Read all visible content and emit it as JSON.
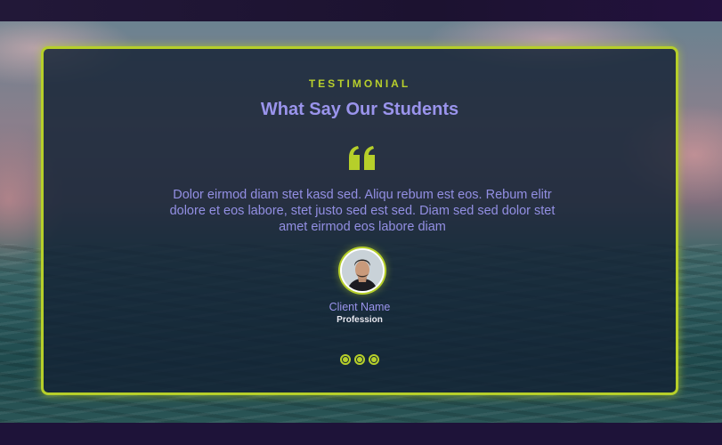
{
  "testimonial": {
    "eyebrow": "TESTIMONIAL",
    "title": "What Say Our Students",
    "quote_icon": "quote-left-icon",
    "text": "Dolor eirmod diam stet kasd sed. Aliqu rebum est eos. Rebum elitr dolore et eos labore, stet justo sed est sed. Diam sed sed dolor stet amet eirmod eos labore diam",
    "client_name": "Client Name",
    "profession": "Profession"
  },
  "carousel": {
    "dots": 3,
    "active_index": 0
  },
  "colors": {
    "accent": "#b6cf2a",
    "heading": "#9a94ec",
    "card_bg": "#142234"
  }
}
